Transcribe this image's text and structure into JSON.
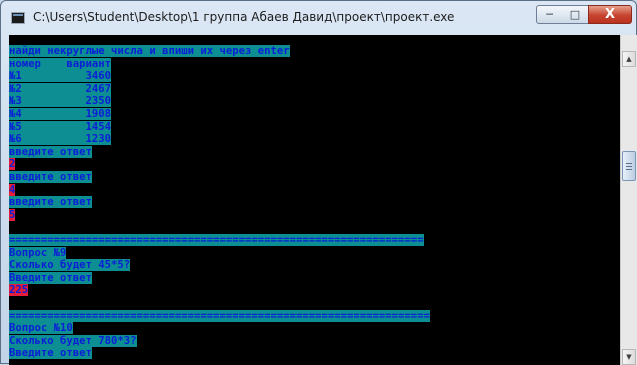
{
  "window": {
    "title": "C:\\Users\\Student\\Desktop\\1 группа Абаев Давид\\проект\\проект.exe"
  },
  "controls": {
    "minimize": "─",
    "maximize": "□",
    "close": "X"
  },
  "console": {
    "lines": [
      {
        "text": "найди некруглые числа и впиши их через enter",
        "kind": "text"
      },
      {
        "text": "номер    вариант",
        "kind": "text"
      },
      {
        "text": "№1          3460",
        "kind": "text"
      },
      {
        "text": "№2          2467",
        "kind": "text"
      },
      {
        "text": "№3          2350",
        "kind": "text"
      },
      {
        "text": "№4          1908",
        "kind": "text"
      },
      {
        "text": "№5          1454",
        "kind": "text"
      },
      {
        "text": "№6          1230",
        "kind": "text"
      },
      {
        "text": "введите ответ",
        "kind": "text"
      },
      {
        "text": "2",
        "kind": "answer"
      },
      {
        "text": "введите ответ",
        "kind": "text"
      },
      {
        "text": "4",
        "kind": "answer"
      },
      {
        "text": "введите ответ",
        "kind": "text"
      },
      {
        "text": "5",
        "kind": "answer"
      },
      {
        "text": "",
        "kind": "blank"
      },
      {
        "text": "=================================================================",
        "kind": "text"
      },
      {
        "text": "Вопрос №9",
        "kind": "text"
      },
      {
        "text": "Сколько будет 45*5?",
        "kind": "text"
      },
      {
        "text": "Введите ответ",
        "kind": "text"
      },
      {
        "text": "225",
        "kind": "answer"
      },
      {
        "text": "",
        "kind": "blank"
      },
      {
        "text": "==================================================================",
        "kind": "text"
      },
      {
        "text": "Вопрос №10",
        "kind": "text"
      },
      {
        "text": "Сколько будет 780*3?",
        "kind": "text"
      },
      {
        "text": "Введите ответ",
        "kind": "text"
      }
    ]
  },
  "colors": {
    "highlight": "#0c8e92",
    "text": "#0a1fd6",
    "answer": "#e31c3b",
    "background": "#000000"
  }
}
